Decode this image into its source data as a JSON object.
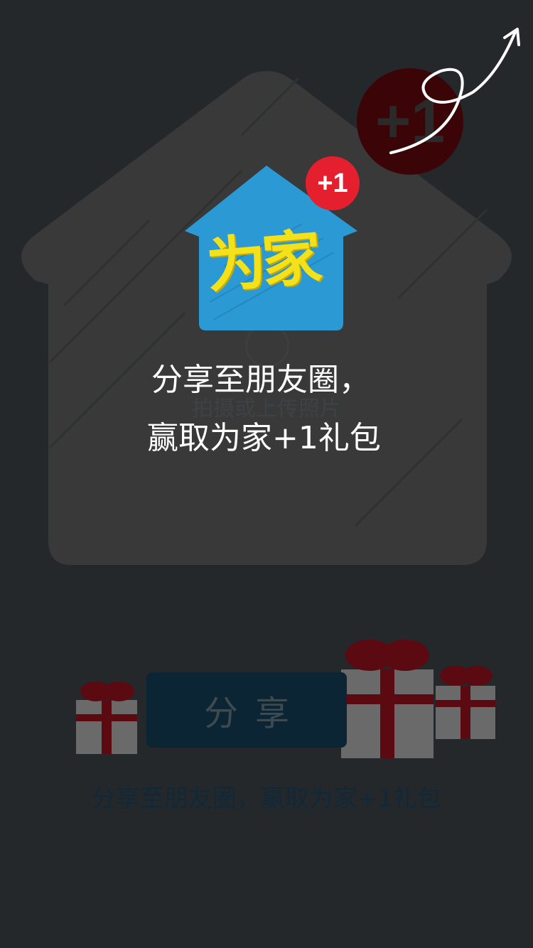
{
  "background": {
    "upload_hint": "拍摄或上传照片",
    "badge_big": "+1"
  },
  "logo": {
    "badge": "+1",
    "text": "为家"
  },
  "overlay": {
    "line1": "分享至朋友圈，",
    "line2": "赢取为家+1礼包"
  },
  "share_button": {
    "label": "分享"
  },
  "caption": "分享至朋友圈，赢取为家+1礼包",
  "colors": {
    "background": "#25282b",
    "house": "#393939",
    "logo_blue": "#2b9ad4",
    "logo_yellow": "#f3e21a",
    "badge_red": "#e5202e",
    "button": "#0b2534"
  },
  "icons": {
    "arrow": "curly-arrow-icon",
    "gifts": [
      "gift-box-icon",
      "gift-box-icon",
      "gift-box-icon"
    ]
  }
}
